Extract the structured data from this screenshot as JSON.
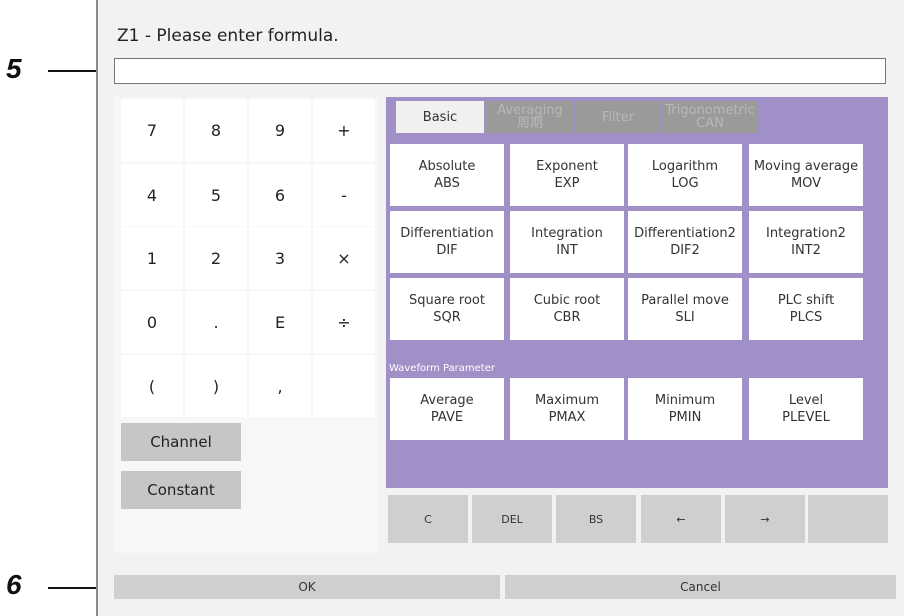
{
  "dialog": {
    "title": "Z1 - Please enter formula.",
    "formula_value": ""
  },
  "keypad": [
    [
      "7",
      "8",
      "9",
      "+"
    ],
    [
      "4",
      "5",
      "6",
      "-"
    ],
    [
      "1",
      "2",
      "3",
      "×"
    ],
    [
      "0",
      ".",
      "E",
      "÷"
    ],
    [
      "(",
      ")",
      ",",
      ""
    ]
  ],
  "left_buttons": {
    "channel": "Channel",
    "constant": "Constant"
  },
  "tabs": [
    {
      "line1": "Basic",
      "line2": ""
    },
    {
      "line1": "Averaging",
      "line2": "周期"
    },
    {
      "line1": "Filter",
      "line2": ""
    },
    {
      "line1": "Trigonometric",
      "line2": "CAN"
    }
  ],
  "functions": [
    {
      "name": "Absolute",
      "code": "ABS"
    },
    {
      "name": "Exponent",
      "code": "EXP"
    },
    {
      "name": "Logarithm",
      "code": "LOG"
    },
    {
      "name": "Moving average",
      "code": "MOV"
    },
    {
      "name": "Differentiation",
      "code": "DIF"
    },
    {
      "name": "Integration",
      "code": "INT"
    },
    {
      "name": "Differentiation2",
      "code": "DIF2"
    },
    {
      "name": "Integration2",
      "code": "INT2"
    },
    {
      "name": "Square root",
      "code": "SQR"
    },
    {
      "name": "Cubic root",
      "code": "CBR"
    },
    {
      "name": "Parallel move",
      "code": "SLI"
    },
    {
      "name": "PLC shift",
      "code": "PLCS"
    }
  ],
  "waveform_section_label": "Waveform Parameter",
  "waveform_params": [
    {
      "name": "Average",
      "code": "PAVE"
    },
    {
      "name": "Maximum",
      "code": "PMAX"
    },
    {
      "name": "Minimum",
      "code": "PMIN"
    },
    {
      "name": "Level",
      "code": "PLEVEL"
    }
  ],
  "control_keys": [
    "C",
    "DEL",
    "BS",
    "←",
    "→",
    ""
  ],
  "footer": {
    "ok": "OK",
    "cancel": "Cancel"
  },
  "callouts": [
    "5",
    "6"
  ],
  "colors": {
    "function_panel": "#a18fc7",
    "button_gray": "#cfcfcf"
  }
}
